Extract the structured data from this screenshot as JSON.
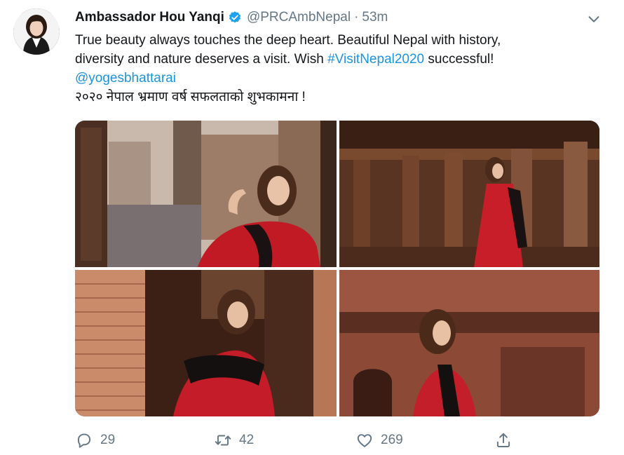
{
  "tweet": {
    "author_name": "Ambassador Hou Yanqi",
    "handle": "@PRCAmbNepal",
    "separator": "·",
    "time": "53m",
    "text_line1": "True beauty always touches the deep heart.  Beautiful Nepal with history,",
    "text_line2_a": "diversity and nature deserves a visit.  Wish ",
    "hashtag": "#VisitNepal2020",
    "text_line2_b": " successful!",
    "mention": "@yogesbhattarai",
    "text_line4": "२०२० नेपाल भ्रमाण वर्ष सफलताको शुभकामना !"
  },
  "actions": {
    "reply_count": "29",
    "retweet_count": "42",
    "like_count": "269"
  },
  "colors": {
    "link": "#1b95e0",
    "verified": "#1da1f2",
    "muted": "#657786"
  },
  "icons": [
    "verified-badge-icon",
    "chevron-down-icon",
    "reply-icon",
    "retweet-icon",
    "like-icon",
    "share-icon"
  ]
}
